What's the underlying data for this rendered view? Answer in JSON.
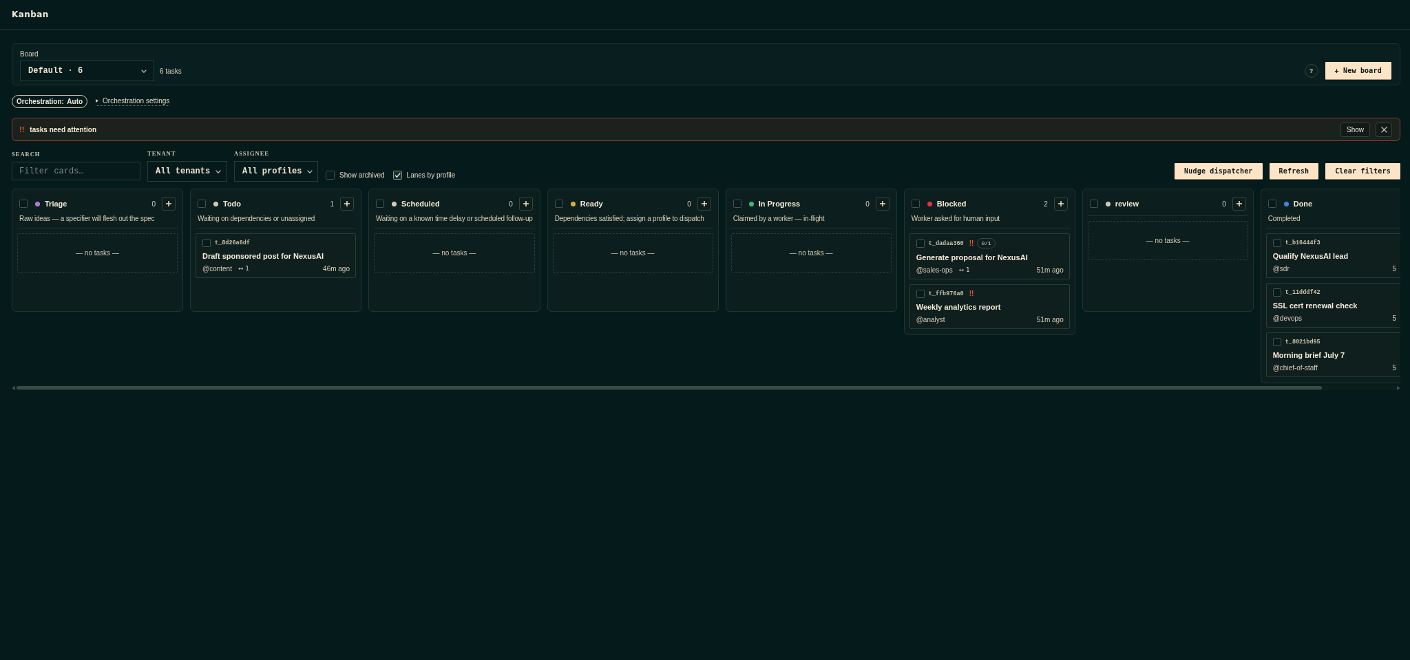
{
  "header": {
    "title": "Kanban"
  },
  "board": {
    "label": "Board",
    "select": {
      "value": "Default · 6"
    },
    "task_count": "6 tasks",
    "help_button": "?",
    "new_button": "+ New board"
  },
  "orchestration": {
    "mode_button": "Orchestration: Auto",
    "settings": {
      "label": "Orchestration settings",
      "expanded": false
    }
  },
  "attention": {
    "marker": "!!",
    "message": "tasks need attention",
    "show_button": "Show"
  },
  "filters": {
    "search": {
      "label": "SEARCH",
      "placeholder": "Filter cards…"
    },
    "tenant": {
      "label": "TENANT",
      "value": "All tenants"
    },
    "assignee": {
      "label": "ASSIGNEE",
      "value": "All profiles"
    },
    "options": [
      {
        "label": "Show archived",
        "checked": false
      },
      {
        "label": "Lanes by profile",
        "checked": true
      }
    ]
  },
  "actions": [
    "Nudge dispatcher",
    "Refresh",
    "Clear filters"
  ],
  "lanes": [
    {
      "name": "Triage",
      "color": "#b27bdc",
      "checked": false,
      "count": "0",
      "description": "Raw ideas — a specifier will flesh out the spec",
      "empty": "— no tasks —"
    },
    {
      "name": "Todo",
      "color": "#d8ccb6",
      "checked": false,
      "count": "1",
      "description": "Waiting on dependencies or unassigned",
      "cards": [
        {
          "id": "t_8d26a6df",
          "checked": false,
          "title": "Draft sponsored post for NexusAI",
          "assignee": "@content",
          "links": "↔ 1",
          "time": "46m ago"
        }
      ]
    },
    {
      "name": "Scheduled",
      "color": "#d8ccb6",
      "checked": false,
      "count": "0",
      "description": "Waiting on a known time delay or scheduled follow-up",
      "empty": "— no tasks —"
    },
    {
      "name": "Ready",
      "color": "#d9ad3b",
      "checked": false,
      "count": "0",
      "description": "Dependencies satisfied; assign a profile to dispatch",
      "empty": "— no tasks —"
    },
    {
      "name": "In Progress",
      "color": "#3dba7c",
      "checked": false,
      "count": "0",
      "description": "Claimed by a worker — in-flight",
      "empty": "— no tasks —"
    },
    {
      "name": "Blocked",
      "color": "#e8333a",
      "checked": false,
      "count": "2",
      "description": "Worker asked for human input",
      "cards": [
        {
          "id": "t_dadaa360",
          "checked": false,
          "alert": "!!",
          "badge": "0/1",
          "title": "Generate proposal for NexusAI",
          "assignee": "@sales-ops",
          "links": "↔ 1",
          "time": "51m ago"
        },
        {
          "id": "t_ffb976a0",
          "checked": false,
          "alert": "!!",
          "title": "Weekly analytics report",
          "assignee": "@analyst",
          "time": "51m ago"
        }
      ]
    },
    {
      "name": "review",
      "color": "#d2c9b8",
      "checked": false,
      "count": "0",
      "empty": "— no tasks —"
    },
    {
      "name": "Done",
      "color": "#3d86d9",
      "checked": false,
      "description": "Completed",
      "cards": [
        {
          "id": "t_b16444f3",
          "checked": false,
          "title": "Qualify NexusAI lead",
          "assignee": "@sdr",
          "time": "5"
        },
        {
          "id": "t_11dddf42",
          "checked": false,
          "title": "SSL cert renewal check",
          "assignee": "@devops",
          "time": "5"
        },
        {
          "id": "t_8021bd95",
          "checked": false,
          "title": "Morning brief July 7",
          "assignee": "@chief-of-staff",
          "time": "5"
        }
      ]
    }
  ]
}
